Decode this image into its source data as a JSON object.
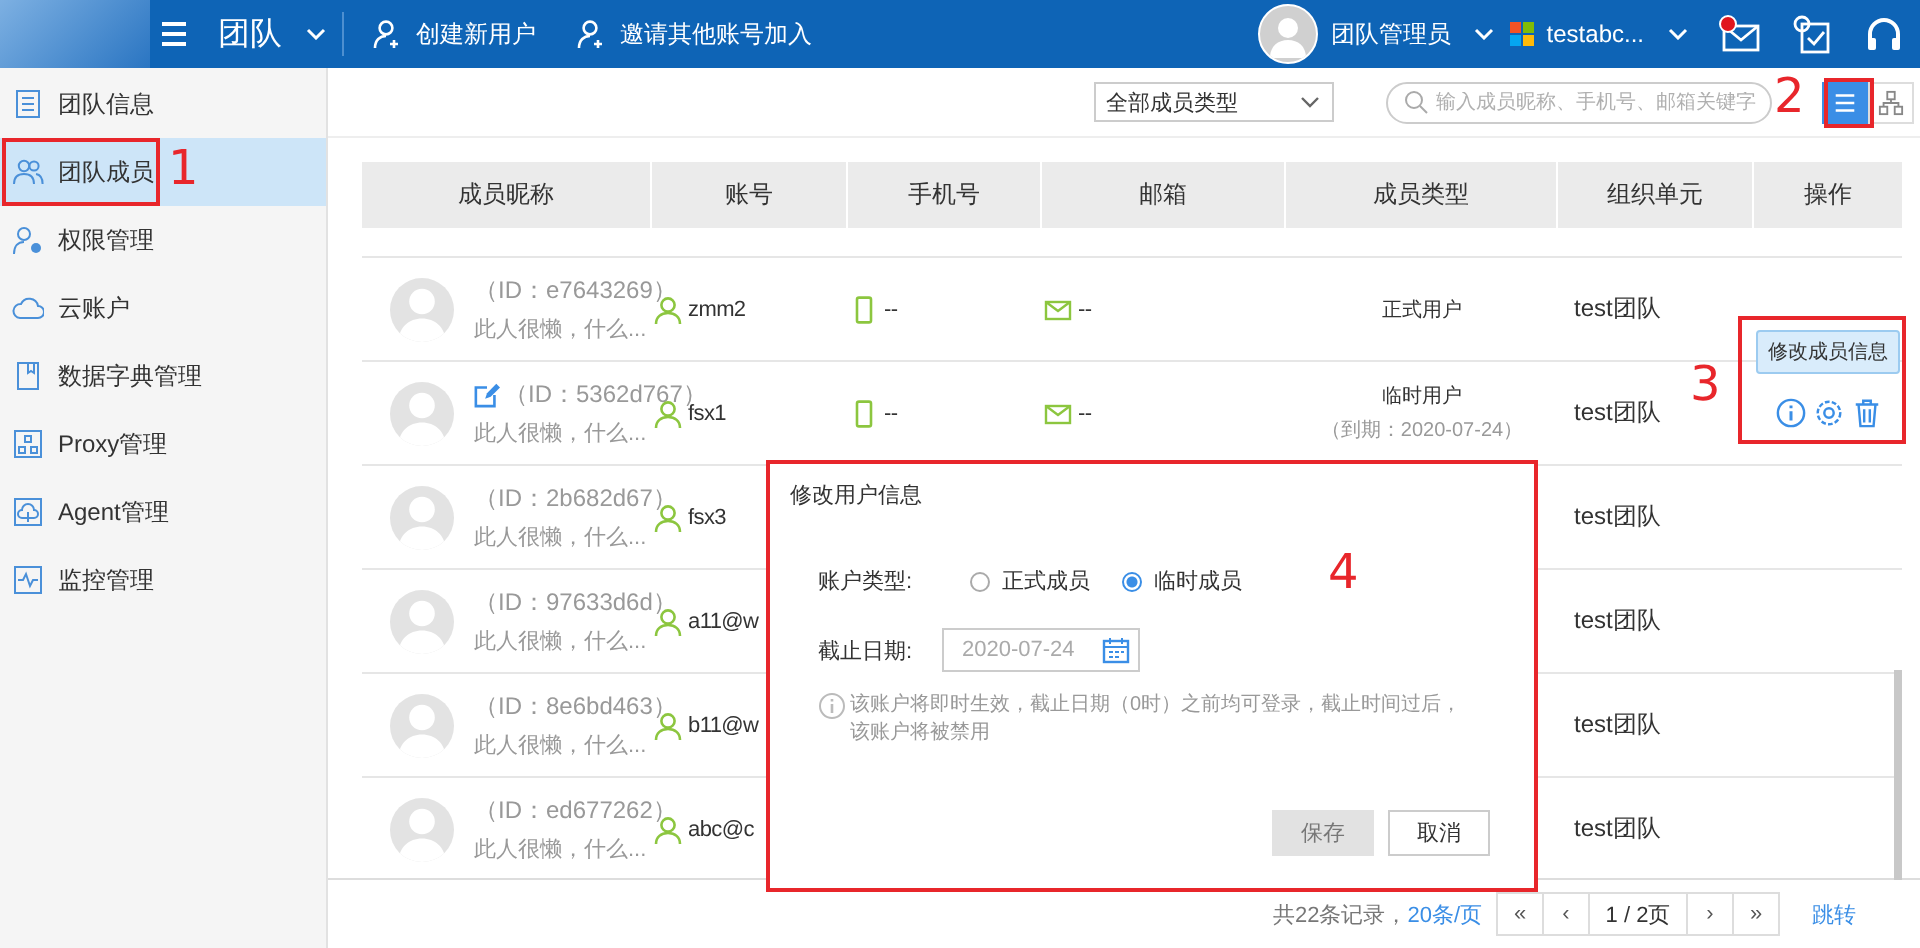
{
  "header": {
    "title": "团队",
    "actions": [
      "创建新用户",
      "邀请其他账号加入"
    ],
    "user": "团队管理员",
    "account": "testabc...",
    "unread": true
  },
  "sidebar": {
    "items": [
      {
        "label": "团队信息",
        "selected": false
      },
      {
        "label": "团队成员",
        "selected": true
      },
      {
        "label": "权限管理",
        "selected": false
      },
      {
        "label": "云账户",
        "selected": false
      },
      {
        "label": "数据字典管理",
        "selected": false
      },
      {
        "label": "Proxy管理",
        "selected": false
      },
      {
        "label": "Agent管理",
        "selected": false
      },
      {
        "label": "监控管理",
        "selected": false
      }
    ]
  },
  "toolbar": {
    "filter": "全部成员类型",
    "placeholder": "输入成员昵称、手机号、邮箱关键字",
    "views": [
      {
        "selected": true
      },
      {
        "selected": false
      }
    ]
  },
  "table": {
    "columns": [
      "成员昵称",
      "账号",
      "手机号",
      "邮箱",
      "成员类型",
      "组织单元",
      "操作"
    ],
    "rows": [
      {
        "id": "（ID：e7643269）",
        "bio": "此人很懒，什么...",
        "account": "zmm2",
        "phone": "--",
        "email": "--",
        "type": "正式用户",
        "org": "test团队"
      },
      {
        "id": "（ID：5362d767）",
        "bio": "此人很懒，什么...",
        "editable": true,
        "account": "fsx1",
        "phone": "--",
        "email": "--",
        "type": "临时用户",
        "expiry": "（到期：2020-07-24）",
        "org": "test团队",
        "actions": true
      },
      {
        "id": "（ID：2b682d67）",
        "bio": "此人很懒，什么...",
        "account": "fsx3",
        "org": "test团队"
      },
      {
        "id": "（ID：97633d6d）",
        "bio": "此人很懒，什么...",
        "account": "a11@w",
        "org": "test团队"
      },
      {
        "id": "（ID：8e6bd463）",
        "bio": "此人很懒，什么...",
        "account": "b11@w",
        "org": "test团队"
      },
      {
        "id": "（ID：ed677262）",
        "bio": "此人很懒，什么...",
        "account": "abc@c",
        "org": "test团队"
      }
    ]
  },
  "tooltip": "修改成员信息",
  "pagination": {
    "summary": "共22条记录，",
    "page_size": "20条/页",
    "nav": [
      "«",
      "‹",
      "1 / 2页",
      "›",
      "»"
    ],
    "jump": "跳转"
  },
  "dialog": {
    "title": "修改用户信息",
    "type_label": "账户类型:",
    "options": [
      {
        "label": "正式成员",
        "selected": false
      },
      {
        "label": "临时成员",
        "selected": true
      }
    ],
    "date_label": "截止日期:",
    "date": "2020-07-24",
    "date_disabled": true,
    "hint": "该账户将即时生效，截止日期（0时）之前均可登录，截止时间过后，该账户将被禁用",
    "buttons": [
      {
        "label": "保存",
        "disabled": true
      },
      {
        "label": "取消",
        "disabled": false
      }
    ]
  },
  "annotations": [
    {
      "label": "1"
    },
    {
      "label": "2"
    },
    {
      "label": "3"
    },
    {
      "label": "4"
    }
  ]
}
